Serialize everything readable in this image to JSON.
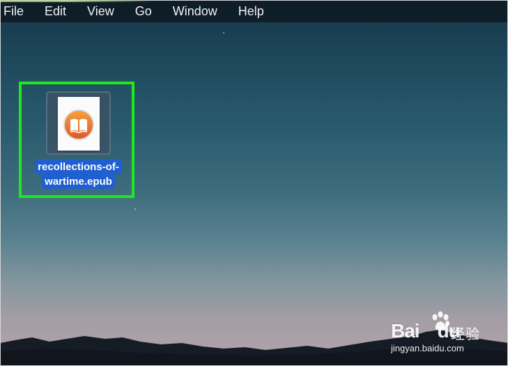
{
  "menubar": {
    "items": [
      "File",
      "Edit",
      "View",
      "Go",
      "Window",
      "Help"
    ]
  },
  "desktop": {
    "file": {
      "name_line1": "recollections-of-",
      "name_line2": "wartime.epub",
      "icon": "ibooks-epub-document-icon"
    },
    "highlight_color": "#1ee81e",
    "selection_color": "#1f5fcf"
  },
  "watermark": {
    "logo_text": "Bai",
    "logo_tail": "du",
    "suffix": "经验",
    "url": "jingyan.baidu.com"
  }
}
